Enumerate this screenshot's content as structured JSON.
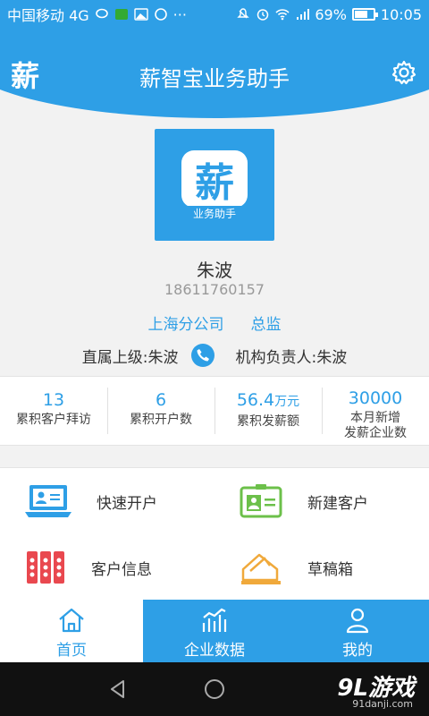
{
  "status_bar": {
    "carrier": "中国移动 4G",
    "network": "4G",
    "battery": "69%",
    "battery_level": 0.69,
    "time": "10:05"
  },
  "header": {
    "logo_text": "薪",
    "title": "薪智宝业务助手",
    "settings_icon": "gear-icon"
  },
  "profile": {
    "avatar_logo": "薪",
    "avatar_caption": "业务助手",
    "name": "朱波",
    "phone": "18611760157",
    "branch": "上海分公司",
    "position": "总监",
    "supervisor": "直属上级:朱波",
    "org_head": "机构负责人:朱波"
  },
  "stats": [
    {
      "value": "13",
      "unit": "",
      "label": "累积客户拜访"
    },
    {
      "value": "6",
      "unit": "",
      "label": "累积开户数"
    },
    {
      "value": "56.4",
      "unit": "万元",
      "label": "累积发薪额"
    },
    {
      "value": "30000",
      "unit": "",
      "label": "本月新增",
      "label2": "发薪企业数"
    }
  ],
  "actions": [
    {
      "label": "快速开户",
      "icon": "computer-user-icon"
    },
    {
      "label": "新建客户",
      "icon": "id-card-icon"
    },
    {
      "label": "客户信息",
      "icon": "binders-icon"
    },
    {
      "label": "草稿箱",
      "icon": "envelope-icon"
    }
  ],
  "tabs": [
    {
      "label": "首页",
      "icon": "home-icon"
    },
    {
      "label": "企业数据",
      "icon": "bar-chart-icon"
    },
    {
      "label": "我的",
      "icon": "person-icon"
    }
  ],
  "watermark": {
    "text": "9L游戏",
    "sub": "91danji.com"
  },
  "colors": {
    "primary": "#2e9fe6",
    "background": "#f2f2f2"
  }
}
